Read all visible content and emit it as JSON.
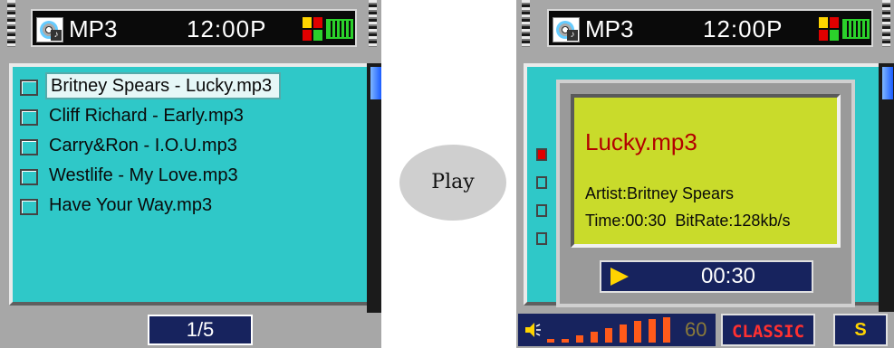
{
  "left_screen": {
    "header": {
      "app_title": "MP3",
      "clock": "12:00P",
      "app_icon": "cd-music-icon",
      "status_icon": "grid-status-icon",
      "battery_icon": "battery-icon"
    },
    "tracks": [
      {
        "title": "Britney Spears - Lucky.mp3",
        "selected": true
      },
      {
        "title": "Cliff Richard - Early.mp3",
        "selected": false
      },
      {
        "title": "Carry&Ron - I.O.U.mp3",
        "selected": false
      },
      {
        "title": "Westlife - My Love.mp3",
        "selected": false
      },
      {
        "title": "Have Your Way.mp3",
        "selected": false
      }
    ],
    "pager": "1/5"
  },
  "transition_label": "Play",
  "right_screen": {
    "header": {
      "app_title": "MP3",
      "clock": "12:00P"
    },
    "now_playing": {
      "title": "Lucky.mp3",
      "artist_line": "Artist:Britney Spears",
      "time_line": "Time:00:30  BitRate:128kb/s"
    },
    "progress": {
      "elapsed": "00:30",
      "play_icon": "play-icon"
    },
    "volume": {
      "level": "60",
      "icon": "speaker-icon"
    },
    "eq_mode": "CLASSIC",
    "srs_label": "S"
  },
  "colors": {
    "panel": "#2fc8c8",
    "info_box": "#c9db2b",
    "title_red": "#b30000",
    "button_navy": "#17235e",
    "volume_orange": "#ff5a1a",
    "eq_red": "#ff3030"
  }
}
